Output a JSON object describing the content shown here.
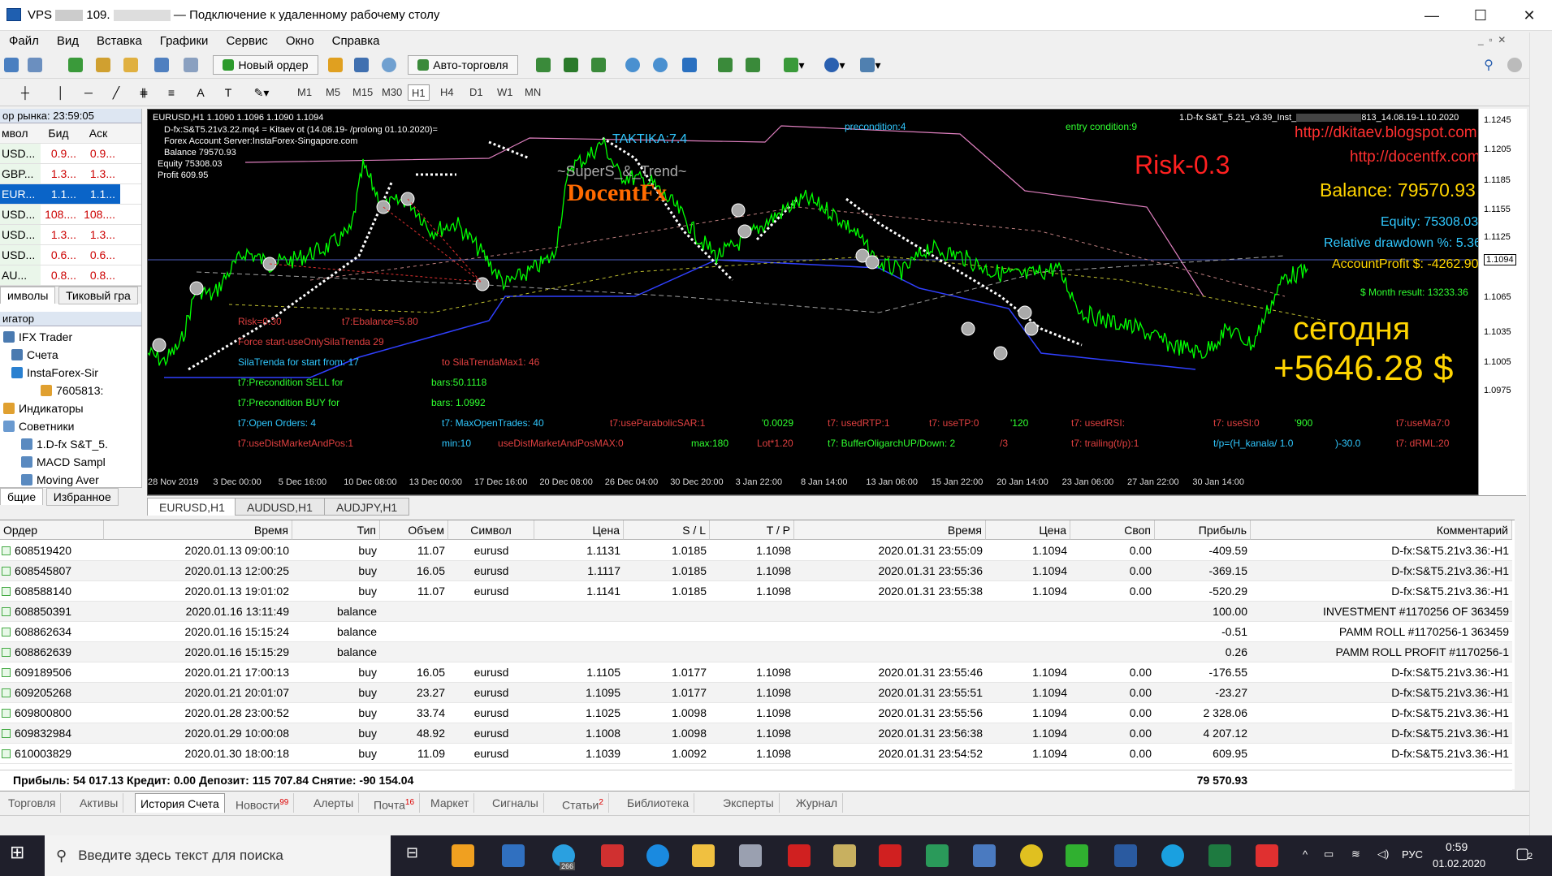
{
  "window": {
    "title_prefix": "VPS",
    "title_ip": "109.",
    "title_suffix": "— Подключение к удаленному рабочему столу"
  },
  "menu": [
    "Файл",
    "Вид",
    "Вставка",
    "Графики",
    "Сервис",
    "Окно",
    "Справка"
  ],
  "toolbar": {
    "new_order": "Новый ордер",
    "autotrading": "Авто-торговля"
  },
  "timeframes": [
    "M1",
    "M5",
    "M15",
    "M30",
    "H1",
    "H4",
    "D1",
    "W1",
    "MN"
  ],
  "selected_timeframe": "H1",
  "market_watch": {
    "title": "ор рынка: 23:59:05",
    "headers": [
      "мвол",
      "Бид",
      "Аск"
    ],
    "rows": [
      {
        "sym": "USD...",
        "bid": "0.9...",
        "ask": "0.9..."
      },
      {
        "sym": "GBP...",
        "bid": "1.3...",
        "ask": "1.3..."
      },
      {
        "sym": "EUR...",
        "bid": "1.1...",
        "ask": "1.1..."
      },
      {
        "sym": "USD...",
        "bid": "108....",
        "ask": "108...."
      },
      {
        "sym": "USD...",
        "bid": "1.3...",
        "ask": "1.3..."
      },
      {
        "sym": "USD...",
        "bid": "0.6...",
        "ask": "0.6..."
      },
      {
        "sym": "AU...",
        "bid": "0.8...",
        "ask": "0.8..."
      }
    ],
    "tabs": [
      "имволы",
      "Тиковый гра"
    ]
  },
  "navigator": {
    "title": "игатор",
    "items": [
      "IFX Trader",
      "Счета",
      "InstaForex-Sir",
      "7605813:",
      "Индикаторы",
      "Советники",
      "1.D-fx S&T_5.",
      "MACD Sampl",
      "Moving Aver"
    ],
    "tabs": [
      "бщие",
      "Избранное"
    ]
  },
  "chart": {
    "header": "EURUSD,H1  1.1090 1.1096 1.1090 1.1094",
    "info_lines": [
      "D-fx:S&T5.21v3.22.mq4 = Kitaev ot (14.08.19- /prolong 01.10.2020)=",
      "Forex Account Server:InstaForex-Singapore.com",
      "Balance  79570.93",
      "Equity  75308.03",
      "Profit  609.95"
    ],
    "ea_title": "1.D-fx S&T_5.21_v3.39_Inst_",
    "ea_title_end": "813_14.08.19-1.10.2020",
    "tactika": "TAKTIKA:7.4",
    "precondition": "precondition:4",
    "entry": "entry condition:9",
    "logo1": "~SuperS_&_Trend~",
    "logo2": "DocentFx",
    "url1": "http://dkitaev.blogspot.com",
    "url2": "http://docentfx.com",
    "risk": "Risk-0.3",
    "balance": "Balance: 79570.93",
    "equity": "Equity: 75308.03",
    "drawdown": "Relative drawdown %: 5.36",
    "accprofit": "AccountProfit $: -4262.90",
    "month": "$ Month result: 13233.36",
    "today_label": "сегодня",
    "today_value": "+5646.28 $",
    "params": [
      {
        "t": "Risk=0.30",
        "c": "#e04040",
        "x": 292,
        "y": 396
      },
      {
        "t": "t7:Ebalance=5.80",
        "c": "#e04040",
        "x": 420,
        "y": 396
      },
      {
        "t": "Force start-useOnlySilaTrenda 29",
        "c": "#e04040",
        "x": 292,
        "y": 421
      },
      {
        "t": "SilaTrenda for start from: 17",
        "c": "#30c8ff",
        "x": 292,
        "y": 446
      },
      {
        "t": "to SilaTrendaMax1: 46",
        "c": "#e04040",
        "x": 543,
        "y": 446
      },
      {
        "t": "t7:Precondition  SELL for",
        "c": "#30ff30",
        "x": 292,
        "y": 471
      },
      {
        "t": "bars:50.1118",
        "c": "#30ff30",
        "x": 530,
        "y": 471
      },
      {
        "t": "t7:Precondition  BUY  for",
        "c": "#30ff30",
        "x": 292,
        "y": 496
      },
      {
        "t": "bars: 1.0992",
        "c": "#30ff30",
        "x": 530,
        "y": 496
      },
      {
        "t": "t7:Open Orders: 4",
        "c": "#30c8ff",
        "x": 292,
        "y": 521
      },
      {
        "t": "t7: MaxOpenTrades: 40",
        "c": "#30c8ff",
        "x": 543,
        "y": 521
      },
      {
        "t": "t7:useParabolicSAR:1",
        "c": "#e04040",
        "x": 750,
        "y": 521
      },
      {
        "t": "'0.0029",
        "c": "#30ff30",
        "x": 937,
        "y": 521
      },
      {
        "t": "t7: usedRTP:1",
        "c": "#e04040",
        "x": 1018,
        "y": 521
      },
      {
        "t": "t7: useTP:0",
        "c": "#e04040",
        "x": 1143,
        "y": 521
      },
      {
        "t": "'120",
        "c": "#30ff30",
        "x": 1243,
        "y": 521
      },
      {
        "t": "t7: usedRSI:",
        "c": "#e04040",
        "x": 1318,
        "y": 521
      },
      {
        "t": "t7: useSl:0",
        "c": "#e04040",
        "x": 1493,
        "y": 521
      },
      {
        "t": "'900",
        "c": "#30ff30",
        "x": 1593,
        "y": 521
      },
      {
        "t": "t7:useMa7:0",
        "c": "#e04040",
        "x": 1718,
        "y": 521
      },
      {
        "t": "t7:useDistMarketAndPos:1",
        "c": "#e04040",
        "x": 292,
        "y": 546
      },
      {
        "t": "min:10",
        "c": "#30c8ff",
        "x": 543,
        "y": 546
      },
      {
        "t": "useDistMarketAndPosMAX:0",
        "c": "#e04040",
        "x": 612,
        "y": 546
      },
      {
        "t": "max:180",
        "c": "#30ff30",
        "x": 850,
        "y": 546
      },
      {
        "t": "Lot*1.20",
        "c": "#e04040",
        "x": 931,
        "y": 546
      },
      {
        "t": "t7: BufferOligarchUP/Down: 2",
        "c": "#30ff30",
        "x": 1018,
        "y": 546
      },
      {
        "t": "/3",
        "c": "#e04040",
        "x": 1230,
        "y": 546
      },
      {
        "t": "t7: trailing(t/p):1",
        "c": "#e04040",
        "x": 1318,
        "y": 546
      },
      {
        "t": "t/p=(H_kanala/ 1.0",
        "c": "#30c8ff",
        "x": 1493,
        "y": 546
      },
      {
        "t": ")-30.0",
        "c": "#30c8ff",
        "x": 1643,
        "y": 546
      },
      {
        "t": "t7: dRML:20",
        "c": "#e04040",
        "x": 1718,
        "y": 546
      }
    ],
    "yticks": [
      "1.1245",
      "1.1205",
      "1.1185",
      "1.1155",
      "1.1125",
      "1.1094",
      "1.1065",
      "1.1035",
      "1.1005",
      "1.0975"
    ],
    "xticks": [
      "28 Nov 2019",
      "3 Dec 00:00",
      "5 Dec 16:00",
      "10 Dec 08:00",
      "13 Dec 00:00",
      "17 Dec 16:00",
      "20 Dec 08:00",
      "26 Dec 04:00",
      "30 Dec 20:00",
      "3 Jan 22:00",
      "8 Jan 14:00",
      "13 Jan 06:00",
      "15 Jan 22:00",
      "20 Jan 14:00",
      "23 Jan 06:00",
      "27 Jan 22:00",
      "30 Jan 14:00"
    ]
  },
  "chart_tabs": [
    "EURUSD,H1",
    "AUDUSD,H1",
    "AUDJPY,H1"
  ],
  "terminal": {
    "headers": [
      "Ордер",
      "Время",
      "Тип",
      "Объем",
      "Символ",
      "Цена",
      "S / L",
      "T / P",
      "Время",
      "Цена",
      "Своп",
      "Прибыль",
      "Комментарий"
    ],
    "rows": [
      [
        "608519420",
        "2020.01.13 09:00:10",
        "buy",
        "11.07",
        "eurusd",
        "1.1131",
        "1.0185",
        "1.1098",
        "2020.01.31 23:55:09",
        "1.1094",
        "0.00",
        "-409.59",
        "D-fx:S&T5.21v3.36:-H1"
      ],
      [
        "608545807",
        "2020.01.13 12:00:25",
        "buy",
        "16.05",
        "eurusd",
        "1.1117",
        "1.0185",
        "1.1098",
        "2020.01.31 23:55:36",
        "1.1094",
        "0.00",
        "-369.15",
        "D-fx:S&T5.21v3.36:-H1"
      ],
      [
        "608588140",
        "2020.01.13 19:01:02",
        "buy",
        "11.07",
        "eurusd",
        "1.1141",
        "1.0185",
        "1.1098",
        "2020.01.31 23:55:38",
        "1.1094",
        "0.00",
        "-520.29",
        "D-fx:S&T5.21v3.36:-H1"
      ],
      [
        "608850391",
        "2020.01.16 13:11:49",
        "balance",
        "",
        "",
        "",
        "",
        "",
        "",
        "",
        "",
        "100.00",
        "INVESTMENT #1170256 OF 363459"
      ],
      [
        "608862634",
        "2020.01.16 15:15:24",
        "balance",
        "",
        "",
        "",
        "",
        "",
        "",
        "",
        "",
        "-0.51",
        "PAMM ROLL #1170256-1 363459"
      ],
      [
        "608862639",
        "2020.01.16 15:15:29",
        "balance",
        "",
        "",
        "",
        "",
        "",
        "",
        "",
        "",
        "0.26",
        "PAMM ROLL PROFIT #1170256-1"
      ],
      [
        "609189506",
        "2020.01.21 17:00:13",
        "buy",
        "16.05",
        "eurusd",
        "1.1105",
        "1.0177",
        "1.1098",
        "2020.01.31 23:55:46",
        "1.1094",
        "0.00",
        "-176.55",
        "D-fx:S&T5.21v3.36:-H1"
      ],
      [
        "609205268",
        "2020.01.21 20:01:07",
        "buy",
        "23.27",
        "eurusd",
        "1.1095",
        "1.0177",
        "1.1098",
        "2020.01.31 23:55:51",
        "1.1094",
        "0.00",
        "-23.27",
        "D-fx:S&T5.21v3.36:-H1"
      ],
      [
        "609800800",
        "2020.01.28 23:00:52",
        "buy",
        "33.74",
        "eurusd",
        "1.1025",
        "1.0098",
        "1.1098",
        "2020.01.31 23:55:56",
        "1.1094",
        "0.00",
        "2 328.06",
        "D-fx:S&T5.21v3.36:-H1"
      ],
      [
        "609832984",
        "2020.01.29 10:00:08",
        "buy",
        "48.92",
        "eurusd",
        "1.1008",
        "1.0098",
        "1.1098",
        "2020.01.31 23:56:38",
        "1.1094",
        "0.00",
        "4 207.12",
        "D-fx:S&T5.21v3.36:-H1"
      ],
      [
        "610003829",
        "2020.01.30 18:00:18",
        "buy",
        "11.09",
        "eurusd",
        "1.1039",
        "1.0092",
        "1.1098",
        "2020.01.31 23:54:52",
        "1.1094",
        "0.00",
        "609.95",
        "D-fx:S&T5.21v3.36:-H1"
      ]
    ],
    "summary": "Прибыль: 54 017.13  Кредит: 0.00  Депозит: 115 707.84  Снятие: -90 154.04",
    "summary_total": "79 570.93"
  },
  "bottom_tabs": [
    {
      "label": "Торговля",
      "badge": ""
    },
    {
      "label": "Активы",
      "badge": ""
    },
    {
      "label": "История Счета",
      "badge": ""
    },
    {
      "label": "Новости",
      "badge": "99"
    },
    {
      "label": "Алерты",
      "badge": ""
    },
    {
      "label": "Почта",
      "badge": "16"
    },
    {
      "label": "Маркет",
      "badge": ""
    },
    {
      "label": "Сигналы",
      "badge": ""
    },
    {
      "label": "Статьи",
      "badge": "2"
    },
    {
      "label": "Библиотека",
      "badge": ""
    },
    {
      "label": "Эксперты",
      "badge": ""
    },
    {
      "label": "Журнал",
      "badge": ""
    }
  ],
  "taskbar": {
    "search": "Введите здесь текст для поиска",
    "lang": "РУС",
    "time": "0:59",
    "date": "01.02.2020",
    "notif": "2",
    "telegram_badge": "266"
  }
}
